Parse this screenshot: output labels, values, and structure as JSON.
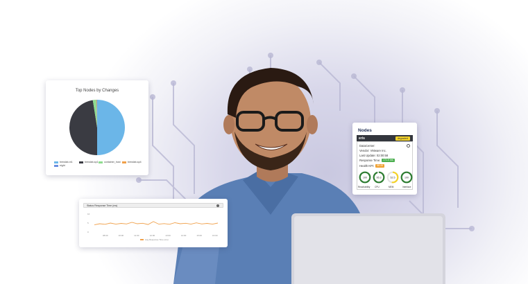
{
  "pie_card": {
    "title": "Top Nodes by Changes",
    "legend": [
      {
        "label": "brewlab-m1",
        "color": "#6bb6e8"
      },
      {
        "label": "brewlab-sp1",
        "color": "#3a3b42"
      },
      {
        "label": "container_host",
        "color": "#8fdc8f"
      },
      {
        "label": "brewlab-sp4",
        "color": "#f0a04a"
      },
      {
        "label": "eight",
        "color": "#6b8fe0"
      }
    ]
  },
  "chart_data": [
    {
      "type": "pie",
      "title": "Top Nodes by Changes",
      "categories": [
        "brewlab-m1",
        "brewlab-sp1",
        "container_host",
        "brewlab-sp4",
        "eight"
      ],
      "values": [
        50,
        47.5,
        2,
        0.3,
        0.2
      ]
    },
    {
      "type": "line",
      "title": "Status Response Time (ms)",
      "series": [
        {
          "name": "Avg Response Time (ms)",
          "values": [
            4,
            4.6,
            4.3,
            5,
            4.4,
            4.8,
            4.5,
            5.4,
            4.6,
            4.9,
            4.2,
            5.8,
            4.4,
            4.7,
            4.3,
            5.2,
            4.6,
            4.9,
            4.4,
            5.1,
            4.5,
            4.8,
            4.4,
            5
          ]
        }
      ],
      "x_ticks": [
        "08:00",
        "10:00",
        "11:00",
        "12:00",
        "13:00",
        "14:00",
        "15:00",
        "16:00"
      ],
      "y_ticks": [
        "10",
        "5",
        "0"
      ],
      "ylim": [
        0,
        10
      ]
    }
  ],
  "line_card": {
    "title": "Status Response Time (ms)",
    "legend_label": "Avg Response Time (ms)",
    "line_color": "#f0a04a"
  },
  "nodes_card": {
    "title": "Nodes",
    "node_name": "eris",
    "status_badge": "degraded",
    "datacenter": "DataCenter:",
    "vendor": "Vendor: VMware Inc.",
    "last_update": "Last Update: 02:00:58",
    "response_label": "Response Time:",
    "response_value": "171.0 ms",
    "health_label": "Health KPI:",
    "health_value": "58.49",
    "gauges": [
      {
        "label": "Reachability",
        "value": "100",
        "color": "#2e7d32",
        "level": 1.0
      },
      {
        "label": "CPU",
        "value": "95.3",
        "color": "#2e7d32",
        "level": 0.95
      },
      {
        "label": "MEM",
        "value": "52.5",
        "color": "#f4d329",
        "level": 0.525
      },
      {
        "label": "Interface",
        "value": "100",
        "color": "#2e7d32",
        "level": 1.0
      }
    ]
  }
}
